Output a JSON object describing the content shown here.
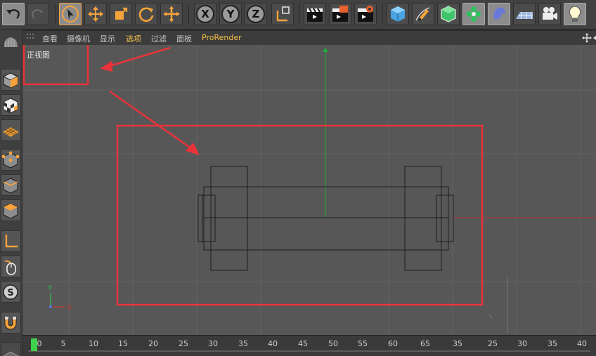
{
  "toolbar": {
    "buttons": [
      {
        "name": "undo-button",
        "icon": "undo-icon"
      },
      {
        "name": "redo-button",
        "icon": "redo-icon"
      },
      {
        "name": "live-selection-button",
        "icon": "cursor-icon"
      },
      {
        "name": "move-button",
        "icon": "move-icon"
      },
      {
        "name": "scale-button",
        "icon": "scale-icon"
      },
      {
        "name": "rotate-button",
        "icon": "rotate-icon"
      },
      {
        "name": "recent-tool-button",
        "icon": "move-icon"
      },
      {
        "name": "x-axis-button",
        "label": "X"
      },
      {
        "name": "y-axis-button",
        "label": "Y"
      },
      {
        "name": "z-axis-button",
        "label": "Z"
      },
      {
        "name": "coordinate-system-button",
        "icon": "world-axis-icon"
      },
      {
        "name": "render-view-button",
        "icon": "clapper-icon"
      },
      {
        "name": "render-picture-viewer-button",
        "icon": "clapper-icon"
      },
      {
        "name": "render-settings-button",
        "icon": "clapper-gear-icon"
      },
      {
        "name": "cube-button",
        "icon": "cube-icon"
      },
      {
        "name": "pen-button",
        "icon": "pen-icon"
      },
      {
        "name": "subdivision-button",
        "icon": "subdivision-icon"
      },
      {
        "name": "cloner-button",
        "icon": "cloner-icon"
      },
      {
        "name": "deformer-button",
        "icon": "deformer-icon"
      },
      {
        "name": "floor-button",
        "icon": "floor-icon"
      },
      {
        "name": "camera-button",
        "icon": "camera-icon"
      },
      {
        "name": "light-button",
        "icon": "light-icon"
      }
    ]
  },
  "palette": {
    "buttons": [
      "layout-icon",
      "model-mode-icon",
      "texture-mode-icon",
      "workplane-icon",
      "points-mode-icon",
      "edges-mode-icon",
      "polygons-mode-icon",
      "axis-mode-icon",
      "tweak-mode-icon",
      "snap-icon",
      "magnet-icon"
    ]
  },
  "viewport_menu": {
    "items": [
      "查看",
      "摄像机",
      "显示",
      "选项",
      "过滤",
      "面板",
      "ProRender"
    ],
    "active_index": 3
  },
  "viewport": {
    "view_label": "正视图",
    "axis_y": "Y",
    "axis_x": "X",
    "colors": {
      "background": "#575757",
      "grid": "#636363",
      "annotation": "#e8333a",
      "y_axis": "#1fae3a",
      "x_axis": "#b43434"
    }
  },
  "timeline": {
    "ticks": [
      "0",
      "5",
      "10",
      "15",
      "20",
      "25",
      "30",
      "35",
      "40",
      "45",
      "50",
      "55",
      "60",
      "65",
      "35",
      "25",
      "30",
      "35",
      "40"
    ],
    "current_frame": "0",
    "playhead_color": "#3ed34a"
  }
}
